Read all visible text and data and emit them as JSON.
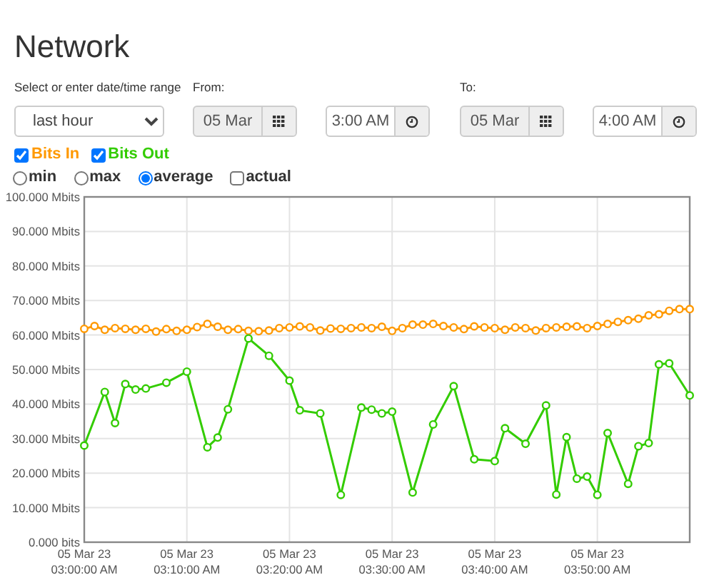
{
  "title": "Network",
  "range": {
    "label": "Select or enter date/time range",
    "value": "last hour"
  },
  "from": {
    "label": "From:",
    "date": "05 Mar",
    "time": "3:00 AM"
  },
  "to": {
    "label": "To:",
    "date": "05 Mar",
    "time": "4:00 AM"
  },
  "series_toggles": [
    {
      "checked": true
    },
    {
      "checked": true
    }
  ],
  "modes": [
    {
      "label": "min",
      "kind": "radio",
      "selected": false
    },
    {
      "label": "max",
      "kind": "radio",
      "selected": false
    },
    {
      "label": "average",
      "kind": "radio",
      "selected": true
    },
    {
      "label": "actual",
      "kind": "checkbox",
      "selected": false
    }
  ],
  "chart_data": {
    "type": "line",
    "grid": true,
    "categories": [
      "05 Mar 23\n03:00:00 AM",
      null,
      null,
      null,
      null,
      null,
      null,
      null,
      null,
      null,
      "05 Mar 23\n03:10:00 AM",
      null,
      null,
      null,
      null,
      null,
      null,
      null,
      null,
      null,
      "05 Mar 23\n03:20:00 AM",
      null,
      null,
      null,
      null,
      null,
      null,
      null,
      null,
      null,
      "05 Mar 23\n03:30:00 AM",
      null,
      null,
      null,
      null,
      null,
      null,
      null,
      null,
      null,
      "05 Mar 23\n03:40:00 AM",
      null,
      null,
      null,
      null,
      null,
      null,
      null,
      null,
      null,
      "05 Mar 23\n03:50:00 AM",
      null,
      null,
      null,
      null,
      null,
      null,
      null,
      null,
      null
    ],
    "ylim": [
      0,
      100
    ],
    "yticks": [
      {
        "value": 0,
        "label": "0.000 bits"
      },
      {
        "value": 10,
        "label": "10.000 Mbits"
      },
      {
        "value": 20,
        "label": "20.000 Mbits"
      },
      {
        "value": 30,
        "label": "30.000 Mbits"
      },
      {
        "value": 40,
        "label": "40.000 Mbits"
      },
      {
        "value": 50,
        "label": "50.000 Mbits"
      },
      {
        "value": 60,
        "label": "60.000 Mbits"
      },
      {
        "value": 70,
        "label": "70.000 Mbits"
      },
      {
        "value": 80,
        "label": "80.000 Mbits"
      },
      {
        "value": 90,
        "label": "90.000 Mbits"
      },
      {
        "value": 100,
        "label": "100.000 Mbits"
      }
    ],
    "series": [
      {
        "name": "Bits In",
        "color": "#ff9900",
        "marker": "circle",
        "values": [
          61.8,
          62.6,
          61.5,
          62,
          61.8,
          61.5,
          61.8,
          61,
          61.7,
          61.2,
          61.5,
          62.3,
          63.2,
          62.4,
          61.5,
          61.7,
          61.2,
          61.1,
          61.3,
          62,
          62.2,
          62.5,
          62.2,
          61.3,
          61.9,
          61.8,
          62,
          62.2,
          62,
          62.4,
          61.2,
          62,
          63,
          63,
          63.2,
          62.6,
          62.2,
          61.7,
          62.5,
          62.2,
          62,
          61.5,
          62.2,
          62,
          61.3,
          62,
          62.2,
          62.4,
          62.5,
          62,
          62.6,
          63.2,
          63.8,
          64.3,
          64.7,
          65.7,
          66,
          67,
          67.5,
          67.5
        ]
      },
      {
        "name": "Bits Out",
        "color": "#33cc00",
        "marker": "circle",
        "values": [
          28,
          null,
          43.5,
          34.5,
          45.8,
          44.2,
          44.5,
          null,
          46.2,
          null,
          49.4,
          null,
          27.5,
          30.3,
          38.5,
          null,
          59,
          null,
          54,
          null,
          46.8,
          38.2,
          null,
          37.3,
          null,
          13.7,
          null,
          39,
          38.4,
          37.3,
          37.8,
          null,
          14.4,
          null,
          34.1,
          null,
          45.2,
          null,
          24,
          null,
          23.5,
          33,
          null,
          28.5,
          null,
          39.6,
          13.8,
          30.4,
          18.4,
          19,
          13.7,
          31.6,
          null,
          16.9,
          27.8,
          28.7,
          51.5,
          51.8,
          null,
          42.5
        ]
      }
    ]
  }
}
